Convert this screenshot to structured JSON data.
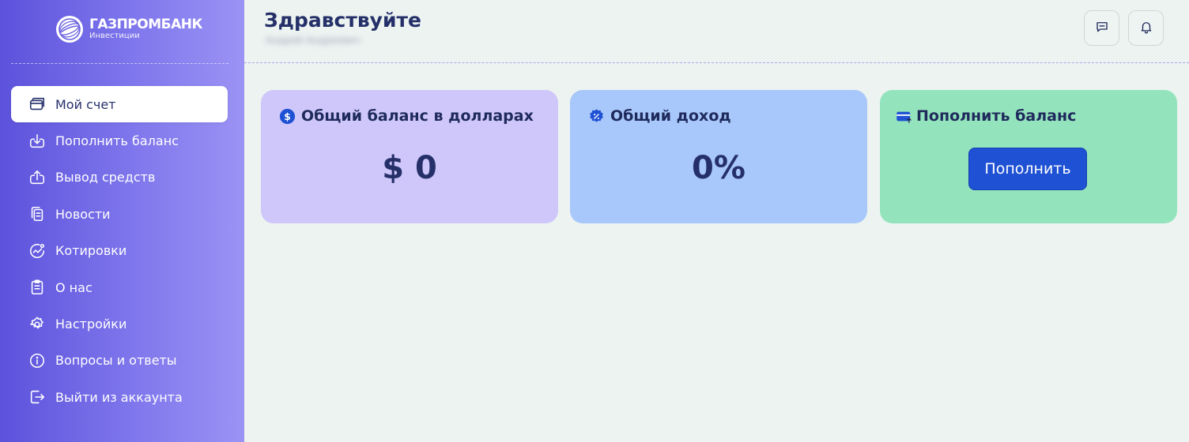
{
  "brand": {
    "title": "ГАЗПРОМБАНК",
    "subtitle": "Инвестиции"
  },
  "sidebar": {
    "items": [
      {
        "label": "Мой счет",
        "icon": "wallet-icon",
        "active": true
      },
      {
        "label": "Пополнить баланс",
        "icon": "download-icon"
      },
      {
        "label": "Вывод средств",
        "icon": "upload-icon"
      },
      {
        "label": "Новости",
        "icon": "documents-icon"
      },
      {
        "label": "Котировки",
        "icon": "chart-circle-icon"
      },
      {
        "label": "О нас",
        "icon": "clipboard-icon"
      },
      {
        "label": "Настройки",
        "icon": "gear-icon"
      },
      {
        "label": "Вопросы и ответы",
        "icon": "info-icon"
      },
      {
        "label": "Выйти из аккаунта",
        "icon": "logout-icon"
      }
    ]
  },
  "header": {
    "greeting": "Здравствуйте",
    "subtitle": "Андрей Андреевич",
    "icons": [
      "chat-icon",
      "bell-icon"
    ]
  },
  "cards": {
    "balance": {
      "title": "Общий баланс в долларах",
      "value": "$ 0",
      "icon": "dollar-icon",
      "color": "#cfc7fa"
    },
    "income": {
      "title": "Общий доход",
      "value": "0%",
      "icon": "percent-badge-icon",
      "color": "#a8c7fa"
    },
    "topup": {
      "title": "Пополнить баланс",
      "button": "Пополнить",
      "icon": "card-icon",
      "color": "#93e4bd"
    }
  },
  "colors": {
    "accent": "#1f51d4",
    "text_dark": "#253069",
    "sidebar_start": "#5c52dc",
    "sidebar_end": "#9b93f4"
  }
}
